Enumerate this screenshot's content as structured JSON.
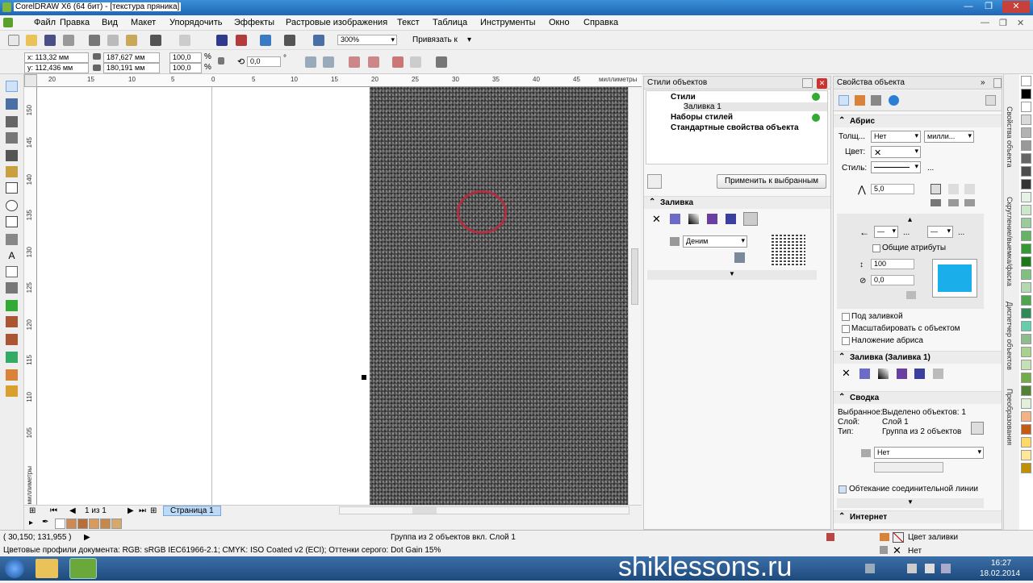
{
  "window": {
    "title": "CorelDRAW X6 (64 бит) - [текстура пряника]",
    "controls": [
      "—",
      "❐",
      "✕"
    ]
  },
  "menu": [
    "Файл",
    "Правка",
    "Вид",
    "Макет",
    "Упорядочить",
    "Эффекты",
    "Растровые изображения",
    "Текст",
    "Таблица",
    "Инструменты",
    "Окно",
    "Справка"
  ],
  "toolbar": {
    "zoom": "300%",
    "snap_label": "Привязать к"
  },
  "property_bar": {
    "x": "x: 113,32 мм",
    "y": "y: 112,436 мм",
    "width": "187,627 мм",
    "height": "180,191 мм",
    "scale_w": "100,0",
    "scale_h": "100,0",
    "percent": "%",
    "rotation": "0,0",
    "degree": "°"
  },
  "ruler": {
    "h_ticks": [
      "20",
      "15",
      "10",
      "5",
      "0",
      "5",
      "10",
      "15",
      "20",
      "25",
      "30",
      "35",
      "40",
      "45"
    ],
    "h_unit": "миллиметры",
    "v_ticks": [
      "150",
      "145",
      "140",
      "135",
      "130",
      "125",
      "120",
      "115",
      "110",
      "105"
    ],
    "v_unit": "миллиметры"
  },
  "page_nav": {
    "counter": "1 из 1",
    "page_tab": "Страница 1"
  },
  "styles_panel": {
    "title": "Стили объектов",
    "tree": [
      "Стили",
      "Заливка 1",
      "Наборы стилей",
      "Стандартные свойства объекта"
    ],
    "apply_button": "Применить к выбранным",
    "fill_section": "Заливка",
    "pattern_name": "Деним"
  },
  "props_panel": {
    "title": "Свойства объекта",
    "outline_section": "Абрис",
    "thickness_label": "Толщ...",
    "thickness_value": "Нет",
    "units_value": "милли...",
    "color_label": "Цвет:",
    "style_label": "Стиль:",
    "miter_value": "5,0",
    "common_attrs": "Общие атрибуты",
    "stretch_value": "100",
    "angle_value": "0,0",
    "behind_fill": "Под заливкой",
    "scale_with_object": "Масштабировать с объектом",
    "overprint": "Наложение абриса",
    "fill_section": "Заливка (Заливка 1)",
    "summary_section": "Сводка",
    "selected_label": "Выбранное:",
    "selected_value": "Выделено объектов: 1",
    "layer_label": "Слой:",
    "layer_value": "Слой 1",
    "type_label": "Тип:",
    "type_value": "Группа из 2 объектов",
    "wrap_value": "Нет",
    "connector_wrap": "Обтекание соединительной линии",
    "internet_section": "Интернет",
    "preview_color": "#1aaeea"
  },
  "dock_tabs": [
    "Свойства объекта",
    "Скругление/выемка/фаска",
    "Диспетчер объектов",
    "Преобразования"
  ],
  "status": {
    "coords": "( 30,150; 131,955 )",
    "object_info": "Группа из 2 объектов вкл. Слой 1",
    "profiles": "Цветовые профили документа: RGB: sRGB IEC61966-2.1; CMYK: ISO Coated v2 (ECI); Оттенки серого: Dot Gain 15%",
    "fill_color": "Цвет заливки",
    "outline_none": "Нет"
  },
  "taskbar": {
    "watermark": "shiklessons.ru",
    "time": "16:27",
    "date": "18.02.2014"
  },
  "palette_colors": [
    "#ffffff",
    "#000000",
    "#cc9966",
    "#e8c8a0",
    "#c69a5c",
    "#d4b078",
    "#a0643c",
    "#f5e6c8"
  ]
}
